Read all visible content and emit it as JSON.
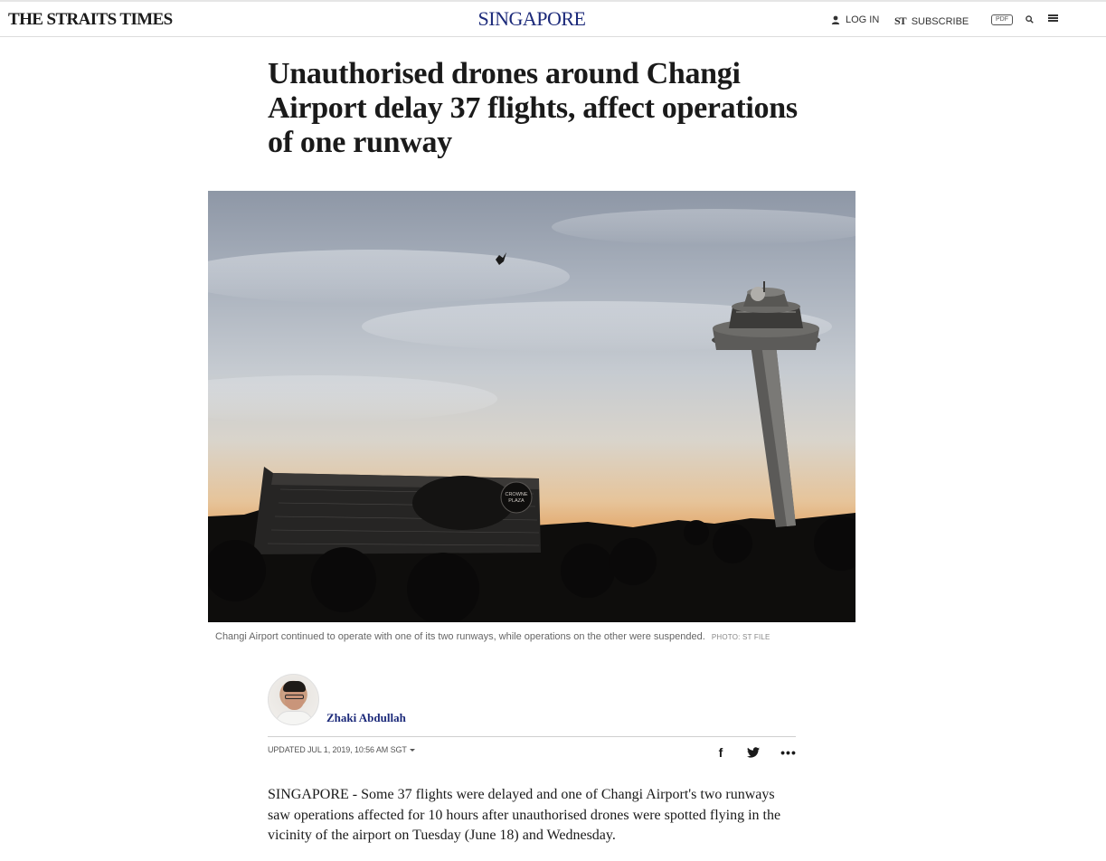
{
  "header": {
    "logo": "THE STRAITS TIMES",
    "section": "SINGAPORE",
    "login_label": "LOG IN",
    "subscribe_mark": "ST",
    "subscribe_label": "SUBSCRIBE",
    "pdf_label": "PDF"
  },
  "article": {
    "headline": "Unauthorised drones around Changi Airport delay 37 flights, affect operations of one runway",
    "photo": {
      "caption": "Changi Airport continued to operate with one of its two runways, while operations on the other were suspended.",
      "credit": "PHOTO: ST FILE",
      "building_sign": "CROWNE PLAZA"
    },
    "byline": {
      "author": "Zhaki Abdullah",
      "updated": "UPDATED JUL 1, 2019, 10:56 AM SGT"
    },
    "share": {
      "facebook": "f",
      "more": "•••"
    },
    "body_paragraph": "SINGAPORE - Some 37 flights were delayed and one of Changi Airport's two runways saw operations affected for 10 hours after unauthorised drones were spotted flying in the vicinity of the airport on Tuesday (June 18) and Wednesday."
  },
  "colors": {
    "brand_blue": "#1c2a7a",
    "text": "#1a1a1a",
    "muted": "#666666"
  },
  "icons": [
    "user-icon",
    "search-icon",
    "menu-icon",
    "facebook-icon",
    "twitter-icon",
    "more-icon"
  ]
}
